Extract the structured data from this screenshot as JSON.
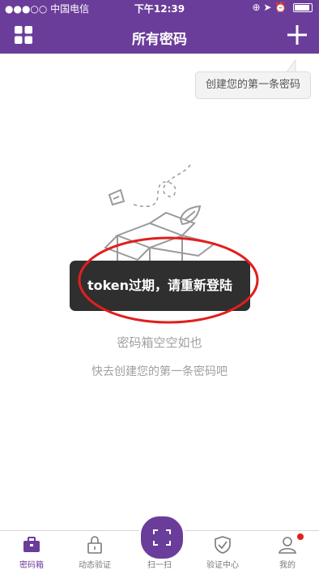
{
  "status_bar": {
    "carrier": "●●●○○ 中国电信",
    "time": "下午12:39",
    "right_icons": "⊕ ➤ ⏰"
  },
  "nav": {
    "title": "所有密码",
    "left_icon": "grid-icon",
    "right_icon": "plus-icon"
  },
  "bubble": {
    "text": "创建您的第一条密码"
  },
  "toast": {
    "text": "token过期，请重新登陆"
  },
  "empty": {
    "main": "密码箱空空如也",
    "sub": "快去创建您的第一条密码吧"
  },
  "tabs": [
    {
      "label": "密码箱",
      "icon": "briefcase-icon",
      "active": true
    },
    {
      "label": "动态验证",
      "icon": "lock-icon",
      "active": false
    },
    {
      "label": "扫一扫",
      "icon": "scan-icon",
      "active": false
    },
    {
      "label": "验证中心",
      "icon": "shield-check-icon",
      "active": false
    },
    {
      "label": "我的",
      "icon": "user-icon",
      "active": false
    }
  ],
  "colors": {
    "brand": "#6b3d9a",
    "toast_bg": "#2f2f2f",
    "annotation_ring": "#e0201d",
    "notification_dot": "#e0201d"
  }
}
